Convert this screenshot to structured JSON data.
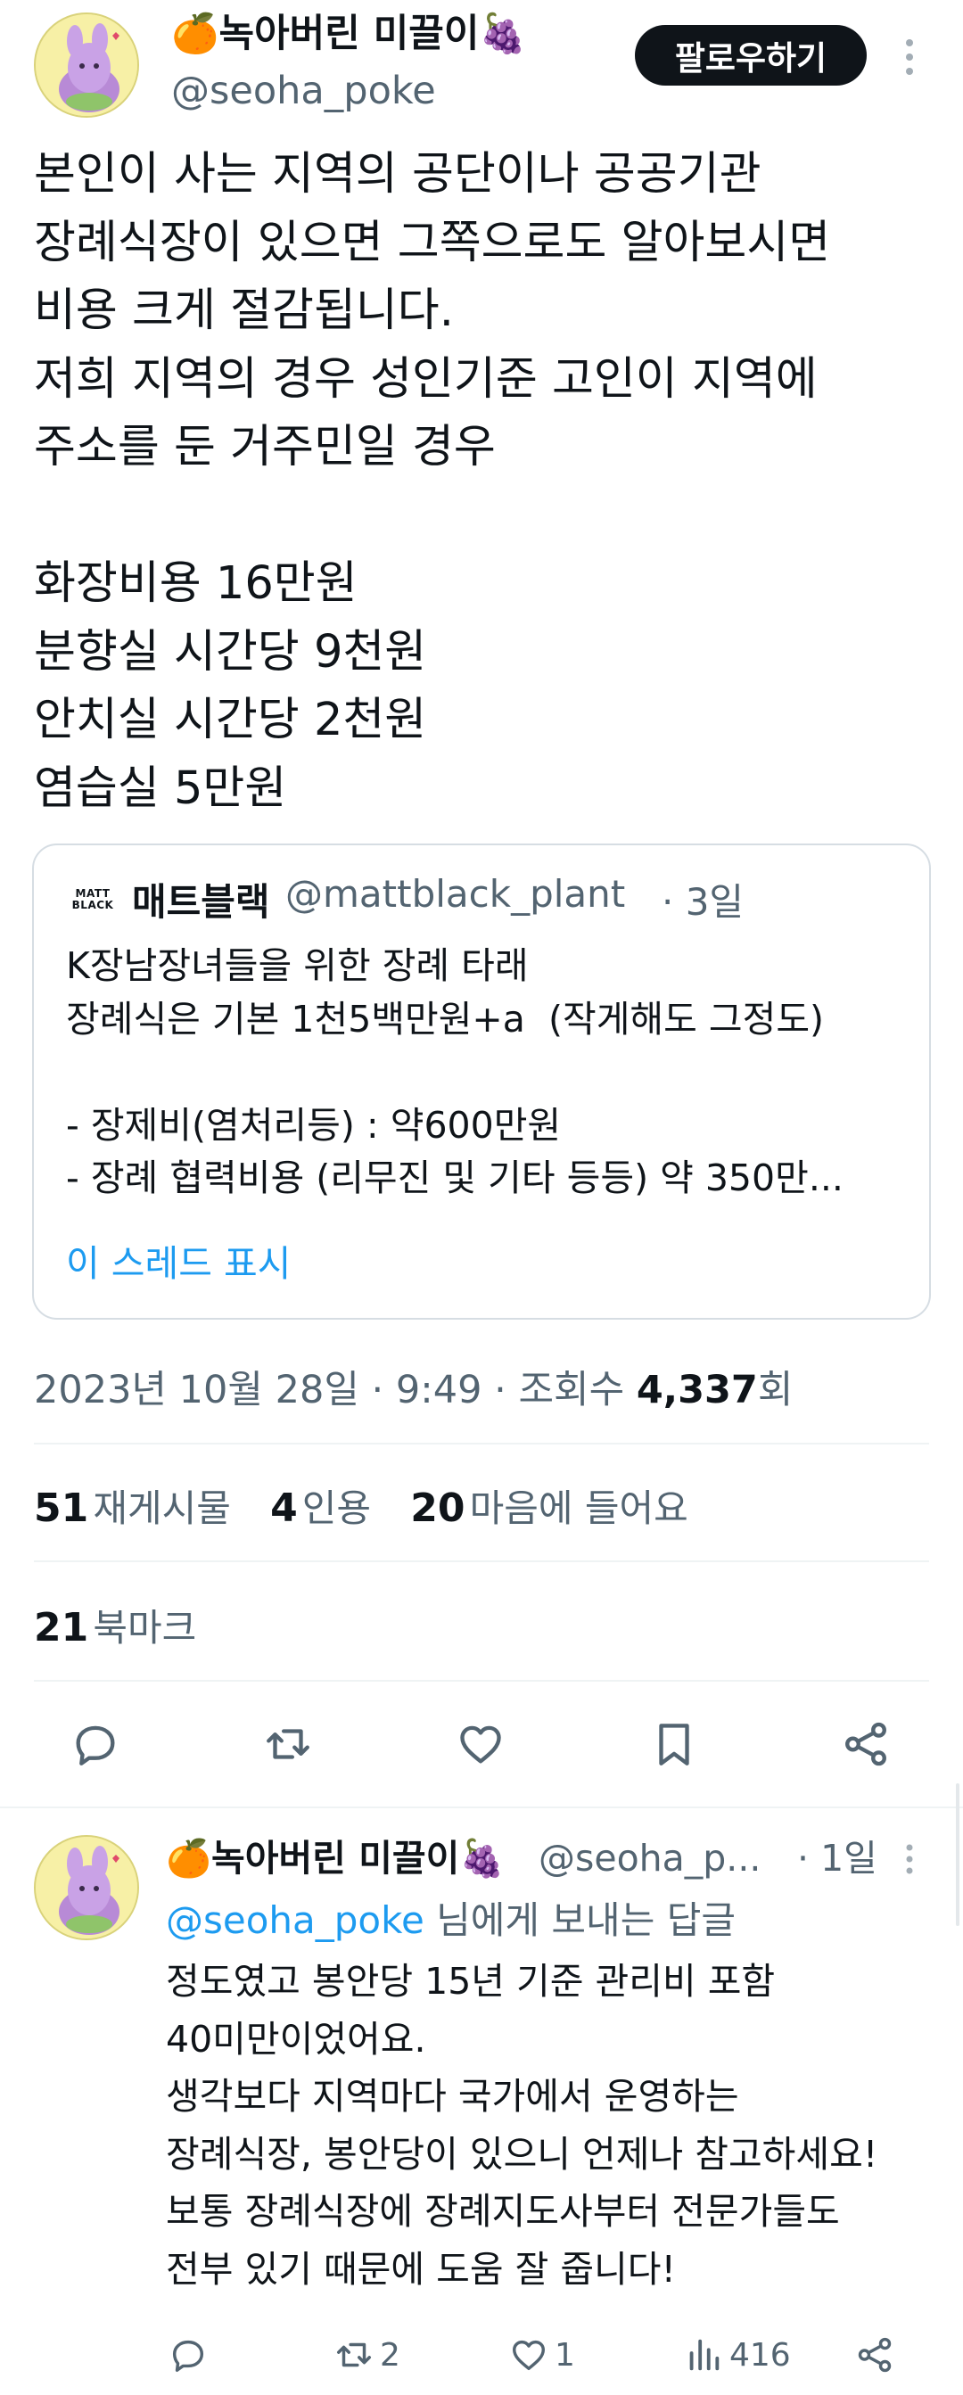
{
  "tweet": {
    "author": {
      "display_name": "🍊녹아버린 미끌이🍇",
      "handle": "@seoha_poke"
    },
    "follow_label": "팔로우하기",
    "more_icon": "more-vertical-icon",
    "text": "본인이 사는 지역의 공단이나 공공기관\n장례식장이 있으면 그쪽으로도 알아보시면\n비용 크게 절감됩니다.\n저희 지역의 경우 성인기준 고인이 지역에\n주소를 둔 거주민일 경우\n\n화장비용 16만원\n분향실 시간당 9천원\n안치실 시간당 2천원\n염습실 5만원",
    "quote": {
      "logo_text": "MATT BLACK",
      "display_name": "매트블랙",
      "handle": "@mattblack_plant",
      "time": "· 3일",
      "text": "K장남장녀들을 위한 장례 타래\n장례식은 기본 1천5백만원+a  (작게해도 그정도)\n\n- 장제비(염처리등) : 약600만원\n- 장례 협력비용 (리무진 및 기타 등등) 약 350만...",
      "show_thread": "이 스레드 표시"
    },
    "meta": {
      "date": "2023년 10월 28일 · 9:49 · 조회수",
      "views": "4,337",
      "views_suffix": "회"
    },
    "stats": {
      "retweets_count": "51",
      "retweets_label": "재게시물",
      "quotes_count": "4",
      "quotes_label": "인용",
      "likes_count": "20",
      "likes_label": "마음에 들어요",
      "bookmarks_count": "21",
      "bookmarks_label": "북마크"
    },
    "actions": [
      "reply-icon",
      "retweet-icon",
      "like-icon",
      "bookmark-icon",
      "share-icon"
    ]
  },
  "reply": {
    "author": {
      "display_name": "🍊녹아버린 미끌이🍇",
      "handle": "@seoha_p...",
      "time": "· 1일"
    },
    "replying_to_handle": "@seoha_poke",
    "replying_to_suffix": " 님에게 보내는 답글",
    "text": "정도였고 봉안당 15년 기준 관리비 포함\n40미만이었어요.\n생각보다 지역마다 국가에서 운영하는\n장례식장, 봉안당이 있으니 언제나 참고하세요!\n보통 장례식장에 장례지도사부터 전문가들도\n전부 있기 때문에 도움 잘 줍니다!",
    "actions": {
      "reply_count": "",
      "retweet_count": "2",
      "like_count": "1",
      "views_count": "416"
    }
  },
  "colors": {
    "accent": "#1d9bf0",
    "secondary_text": "#536471",
    "border": "#eff3f4"
  }
}
